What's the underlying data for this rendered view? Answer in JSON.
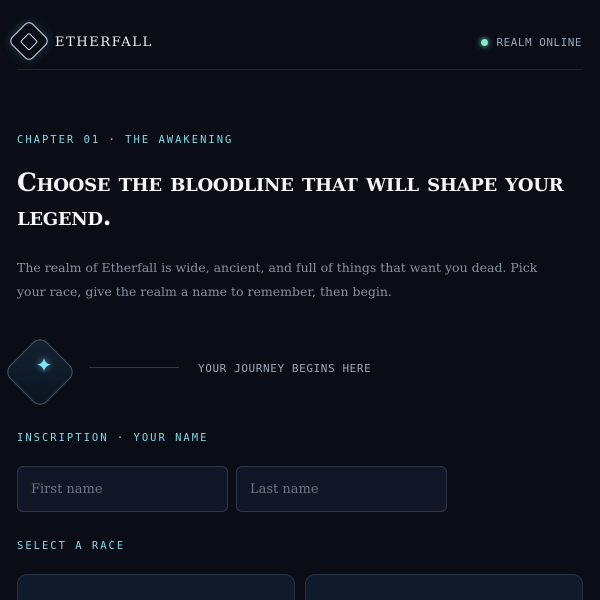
{
  "header": {
    "brand": "ETHERFALL",
    "status": "REALM ONLINE"
  },
  "hero": {
    "chapter": "CHAPTER 01 · THE AWAKENING",
    "title": "Choose the bloodline that will shape your legend.",
    "intro": "The realm of Etherfall is wide, ancient, and full of things that want you dead. Pick your race, give the realm a name to remember, then begin."
  },
  "journey": {
    "text": "YOUR JOURNEY BEGINS HERE"
  },
  "form": {
    "name_label": "INSCRIPTION · YOUR NAME",
    "first_name_placeholder": "First name",
    "last_name_placeholder": "Last name",
    "race_label": "SELECT A RACE"
  },
  "colors": {
    "background": "#0a0d16",
    "accent": "#7fd9e6",
    "status": "#7ff0c8"
  }
}
